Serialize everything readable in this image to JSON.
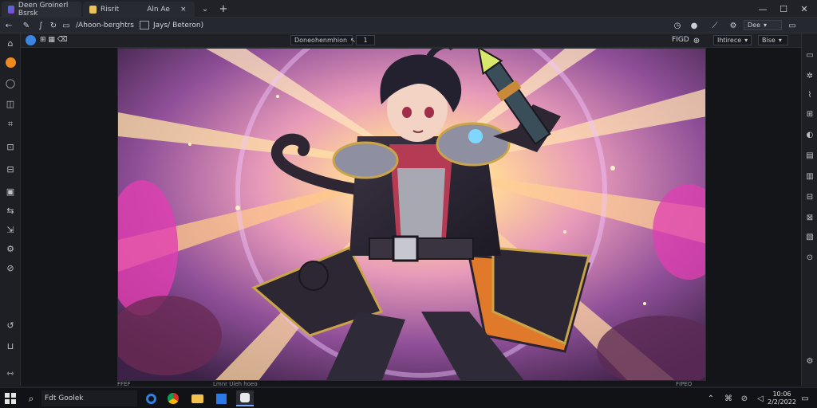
{
  "tabs": [
    {
      "label": "Deen Groinerl Bsrsk",
      "icon": "app-logo-icon"
    },
    {
      "label": "Risrit",
      "extra": "Aln Ae",
      "icon": "tab-icon"
    }
  ],
  "tab_extra_close": "×",
  "new_tab": "+",
  "tab_dropdown": "⌄",
  "window_controls": {
    "minimize": "—",
    "maximize": "☐",
    "close": "✕"
  },
  "address": {
    "path_text": "/Ahoon-berghtrs",
    "path2": "Jays/ Beteron)"
  },
  "toolbar": {
    "breadcrumb": "⊞ ▦ ⌫",
    "center_field": "Doneohenmhion",
    "center_arrow": "↖",
    "page": "1",
    "right_label": "FIGD",
    "mode_select": "Ihtirece",
    "view_select": "Bise"
  },
  "status": {
    "left": "FFEF",
    "center": "Lmnr  Uieh hoeo",
    "right": "FIPEO"
  },
  "taskbar": {
    "search_text": "Fdt Goolek",
    "time": "10:06",
    "date": "2/2/2022"
  },
  "colors": {
    "accent": "#f08a1c",
    "canvas_glow": "#ffd8a8",
    "magenta": "#e23fb2"
  }
}
